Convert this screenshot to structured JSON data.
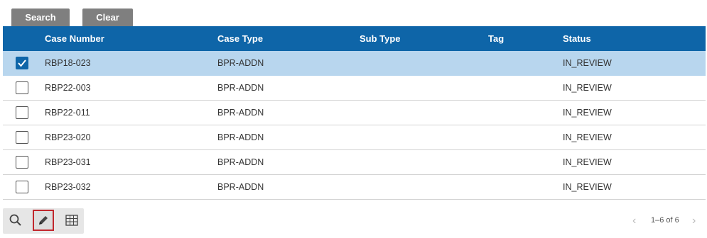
{
  "buttons": {
    "search": "Search",
    "clear": "Clear"
  },
  "columns": [
    "Case Number",
    "Case Type",
    "Sub Type",
    "Tag",
    "Status"
  ],
  "rows": [
    {
      "case_number": "RBP18-023",
      "case_type": "BPR-ADDN",
      "sub_type": "",
      "tag": "",
      "status": "IN_REVIEW",
      "selected": true
    },
    {
      "case_number": "RBP22-003",
      "case_type": "BPR-ADDN",
      "sub_type": "",
      "tag": "",
      "status": "IN_REVIEW",
      "selected": false
    },
    {
      "case_number": "RBP22-011",
      "case_type": "BPR-ADDN",
      "sub_type": "",
      "tag": "",
      "status": "IN_REVIEW",
      "selected": false
    },
    {
      "case_number": "RBP23-020",
      "case_type": "BPR-ADDN",
      "sub_type": "",
      "tag": "",
      "status": "IN_REVIEW",
      "selected": false
    },
    {
      "case_number": "RBP23-031",
      "case_type": "BPR-ADDN",
      "sub_type": "",
      "tag": "",
      "status": "IN_REVIEW",
      "selected": false
    },
    {
      "case_number": "RBP23-032",
      "case_type": "BPR-ADDN",
      "sub_type": "",
      "tag": "",
      "status": "IN_REVIEW",
      "selected": false
    }
  ],
  "toolbar": {
    "icons": [
      "search-icon",
      "pencil-edit-icon",
      "table-grid-icon"
    ]
  },
  "pager": {
    "info": "1–6 of 6",
    "prev": "‹",
    "next": "›"
  },
  "colors": {
    "header_bg": "#0e65a8",
    "selected_row_bg": "#b8d6ee",
    "button_bg": "#7f7f7f",
    "edit_highlight": "#c1272d"
  }
}
